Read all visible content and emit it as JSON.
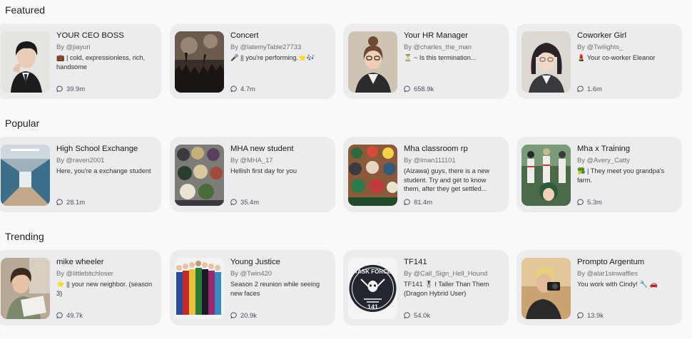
{
  "sections": [
    {
      "title": "Featured",
      "cards": [
        {
          "name": "YOUR CEO BOSS",
          "author": "By @jiayuri",
          "desc": "💼 | cold, expressionless, rich, handsome",
          "count": "39.9m",
          "thumb": "ceo-portrait"
        },
        {
          "name": "Concert",
          "author": "By @latemyTable27733",
          "desc": "🎤 || you're performing.⭐🎶",
          "count": "4.7m",
          "thumb": "concert-crowd"
        },
        {
          "name": "Your HR Manager",
          "author": "By @charles_the_man",
          "desc": "⏳ ~ Is this termination...",
          "count": "658.9k",
          "thumb": "hr-manager-portrait"
        },
        {
          "name": "Coworker Girl",
          "author": "By @Twilights_",
          "desc": "💄 Your co-worker Eleanor",
          "count": "1.6m",
          "thumb": "coworker-girl-portrait"
        }
      ]
    },
    {
      "title": "Popular",
      "cards": [
        {
          "name": "High School Exchange",
          "author": "By @raven2001",
          "desc": "Here, you're a exchange student",
          "count": "28.1m",
          "thumb": "school-hallway"
        },
        {
          "name": "MHA new student",
          "author": "By @MHA_17",
          "desc": "Hellish first day for you",
          "count": "35.4m",
          "thumb": "anime-group"
        },
        {
          "name": "Mha classroom rp",
          "author": "By @lman111101",
          "desc": "(Aizawa) guys, there is a new student. Try and get to know them, after they get settled...",
          "count": "81.4m",
          "thumb": "anime-class"
        },
        {
          "name": "Mha x Training",
          "author": "By @Avery_Catty",
          "desc": "🥦 | They meet you grandpa's farm.",
          "count": "5.3m",
          "thumb": "anime-training"
        }
      ]
    },
    {
      "title": "Trending",
      "cards": [
        {
          "name": "mike wheeler",
          "author": "By @littlebitchloser",
          "desc": "⭐ || your new neighbor. (season 3)",
          "count": "49.7k",
          "thumb": "mike-reading"
        },
        {
          "name": "Young Justice",
          "author": "By @Twin420",
          "desc": "Season 2 reunion while seeing new faces",
          "count": "20.9k",
          "thumb": "heroes-lineup"
        },
        {
          "name": "TF141",
          "author": "By @Call_Sign_Hell_Hound",
          "desc": "TF141 🎖 I Taller Than Them (Dragon Hybrid User)",
          "count": "54.0k",
          "thumb": "task-force-logo"
        },
        {
          "name": "Prompto Argentum",
          "author": "By @alar1sinwaffles",
          "desc": "You work with Cindy! 🔧 🚗",
          "count": "13.9k",
          "thumb": "prompto-camera"
        }
      ]
    }
  ],
  "logo_text": {
    "top": "TASK FORCE",
    "bottom": "141"
  },
  "count_icon": "chat-bubble-icon"
}
